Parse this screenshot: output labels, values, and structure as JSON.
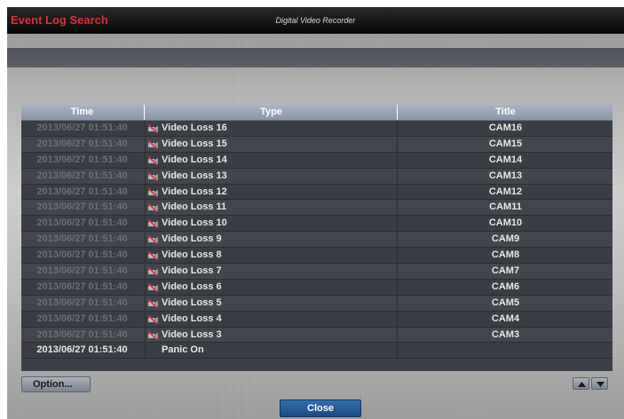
{
  "window": {
    "title": "Event Log Search",
    "subtitle": "Digital Video Recorder"
  },
  "table": {
    "columns": [
      "Time",
      "Type",
      "Title"
    ],
    "rows": [
      {
        "time": "2013/06/27  01:51:40",
        "type": "Video Loss 16",
        "title": "CAM16",
        "icon": "video-loss-icon",
        "active": false
      },
      {
        "time": "2013/06/27  01:51:40",
        "type": "Video Loss 15",
        "title": "CAM15",
        "icon": "video-loss-icon",
        "active": false
      },
      {
        "time": "2013/06/27  01:51:40",
        "type": "Video Loss 14",
        "title": "CAM14",
        "icon": "video-loss-icon",
        "active": false
      },
      {
        "time": "2013/06/27  01:51:40",
        "type": "Video Loss 13",
        "title": "CAM13",
        "icon": "video-loss-icon",
        "active": false
      },
      {
        "time": "2013/06/27  01:51:40",
        "type": "Video Loss 12",
        "title": "CAM12",
        "icon": "video-loss-icon",
        "active": false
      },
      {
        "time": "2013/06/27  01:51:40",
        "type": "Video Loss 11",
        "title": "CAM11",
        "icon": "video-loss-icon",
        "active": false
      },
      {
        "time": "2013/06/27  01:51:40",
        "type": "Video Loss 10",
        "title": "CAM10",
        "icon": "video-loss-icon",
        "active": false
      },
      {
        "time": "2013/06/27  01:51:40",
        "type": "Video Loss 9",
        "title": "CAM9",
        "icon": "video-loss-icon",
        "active": false
      },
      {
        "time": "2013/06/27  01:51:40",
        "type": "Video Loss 8",
        "title": "CAM8",
        "icon": "video-loss-icon",
        "active": false
      },
      {
        "time": "2013/06/27  01:51:40",
        "type": "Video Loss 7",
        "title": "CAM7",
        "icon": "video-loss-icon",
        "active": false
      },
      {
        "time": "2013/06/27  01:51:40",
        "type": "Video Loss 6",
        "title": "CAM6",
        "icon": "video-loss-icon",
        "active": false
      },
      {
        "time": "2013/06/27  01:51:40",
        "type": "Video Loss 5",
        "title": "CAM5",
        "icon": "video-loss-icon",
        "active": false
      },
      {
        "time": "2013/06/27  01:51:40",
        "type": "Video Loss 4",
        "title": "CAM4",
        "icon": "video-loss-icon",
        "active": false
      },
      {
        "time": "2013/06/27  01:51:40",
        "type": "Video Loss 3",
        "title": "CAM3",
        "icon": "video-loss-icon",
        "active": false
      },
      {
        "time": "2013/06/27  01:51:40",
        "type": "Panic On",
        "title": "",
        "icon": "",
        "active": true
      }
    ]
  },
  "buttons": {
    "option": "Option...",
    "close": "Close",
    "scroll_up": "up-arrow-icon",
    "scroll_down": "down-arrow-icon"
  },
  "colors": {
    "title_accent": "#d8303a",
    "header_bg": "#9aa3b6",
    "close_button": "#245c9c"
  }
}
